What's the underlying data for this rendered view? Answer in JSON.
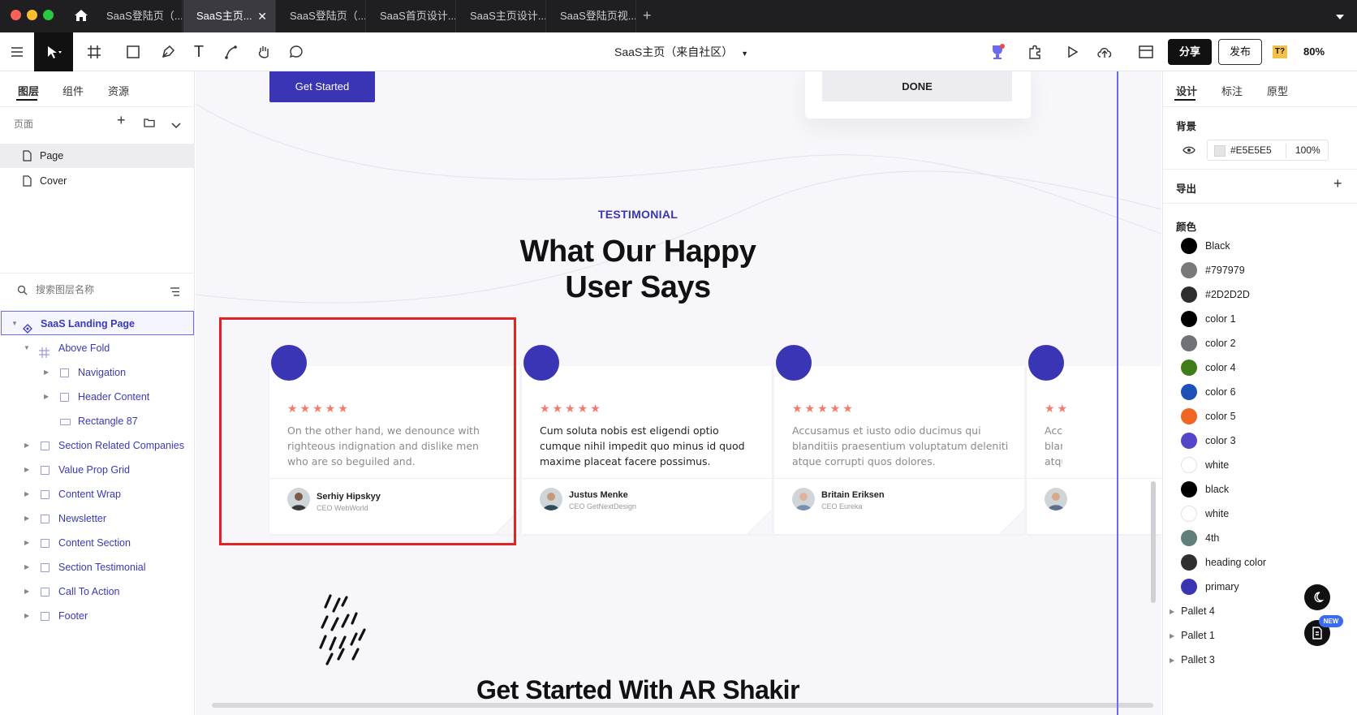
{
  "tabs": [
    {
      "label": "SaaS登陆页（..."
    },
    {
      "label": "SaaS主页..."
    },
    {
      "label": "SaaS登陆页（..."
    },
    {
      "label": "SaaS首页设计..."
    },
    {
      "label": "SaaS主页设计..."
    },
    {
      "label": "SaaS登陆页视..."
    }
  ],
  "toolbar": {
    "file_title": "SaaS主页（来自社区）",
    "share_label": "分享",
    "publish_label": "发布",
    "zoom": "80%"
  },
  "left_panel": {
    "tabs": [
      "图层",
      "组件",
      "资源"
    ],
    "pages_label": "页面",
    "pages": [
      "Page",
      "Cover"
    ],
    "search_placeholder": "搜索图层名称",
    "layers": [
      {
        "name": "SaaS Landing Page"
      },
      {
        "name": "Above Fold"
      },
      {
        "name": "Navigation"
      },
      {
        "name": "Header Content"
      },
      {
        "name": "Rectangle 87"
      },
      {
        "name": "Section Related Companies"
      },
      {
        "name": "Value Prop Grid"
      },
      {
        "name": "Content Wrap"
      },
      {
        "name": "Newsletter"
      },
      {
        "name": "Content Section"
      },
      {
        "name": "Section Testimonial"
      },
      {
        "name": "Call To Action"
      },
      {
        "name": "Footer"
      }
    ]
  },
  "canvas": {
    "get_started_button": "Get Started",
    "done_button": "DONE",
    "section_tag": "TESTIMONIAL",
    "heading_line1": "What Our Happy",
    "heading_line2": "User Says",
    "cta_heading": "Get Started With AR Shakir",
    "cards": [
      {
        "text": "On the other hand, we denounce with righteous indignation and dislike men who are so beguiled and.",
        "name": "Serhiy Hipskyy",
        "role": "CEO WebWorld"
      },
      {
        "text": "Cum soluta nobis est eligendi optio cumque nihil impedit quo minus id quod maxime placeat facere possimus.",
        "name": "Justus Menke",
        "role": "CEO GetNextDesign"
      },
      {
        "text": "Accusamus et iusto odio ducimus qui blanditiis praesentium voluptatum deleniti atque corrupti quos dolores.",
        "name": "Britain Eriksen",
        "role": "CEO Eureka"
      }
    ],
    "partial_card_text": "Acc blan atqu"
  },
  "right_panel": {
    "tabs": [
      "设计",
      "标注",
      "原型"
    ],
    "background_label": "背景",
    "background_hex": "#E5E5E5",
    "background_opacity": "100%",
    "export_label": "导出",
    "colors_label": "颜色",
    "colors": [
      {
        "name": "Black",
        "hex": "#000000"
      },
      {
        "name": "#797979",
        "hex": "#797979"
      },
      {
        "name": "#2D2D2D",
        "hex": "#2D2D2D"
      },
      {
        "name": "color 1",
        "hex": "#000000"
      },
      {
        "name": "color 2",
        "hex": "#6f7378"
      },
      {
        "name": "color 4",
        "hex": "#3e7d17"
      },
      {
        "name": "color 6",
        "hex": "#1f4fb8"
      },
      {
        "name": "color 5",
        "hex": "#f06424"
      },
      {
        "name": "color 3",
        "hex": "#5545c8"
      },
      {
        "name": "white",
        "hex": "#ffffff"
      },
      {
        "name": "black",
        "hex": "#000000"
      },
      {
        "name": "white",
        "hex": "#ffffff"
      },
      {
        "name": "4th",
        "hex": "#5f7f7a"
      },
      {
        "name": "heading color",
        "hex": "#2f2f2f"
      },
      {
        "name": "primary",
        "hex": "#3a35b5"
      }
    ],
    "pallets": [
      "Pallet 4",
      "Pallet 1",
      "Pallet 3"
    ],
    "new_badge": "NEW"
  },
  "accent_color": "#3a35b5"
}
